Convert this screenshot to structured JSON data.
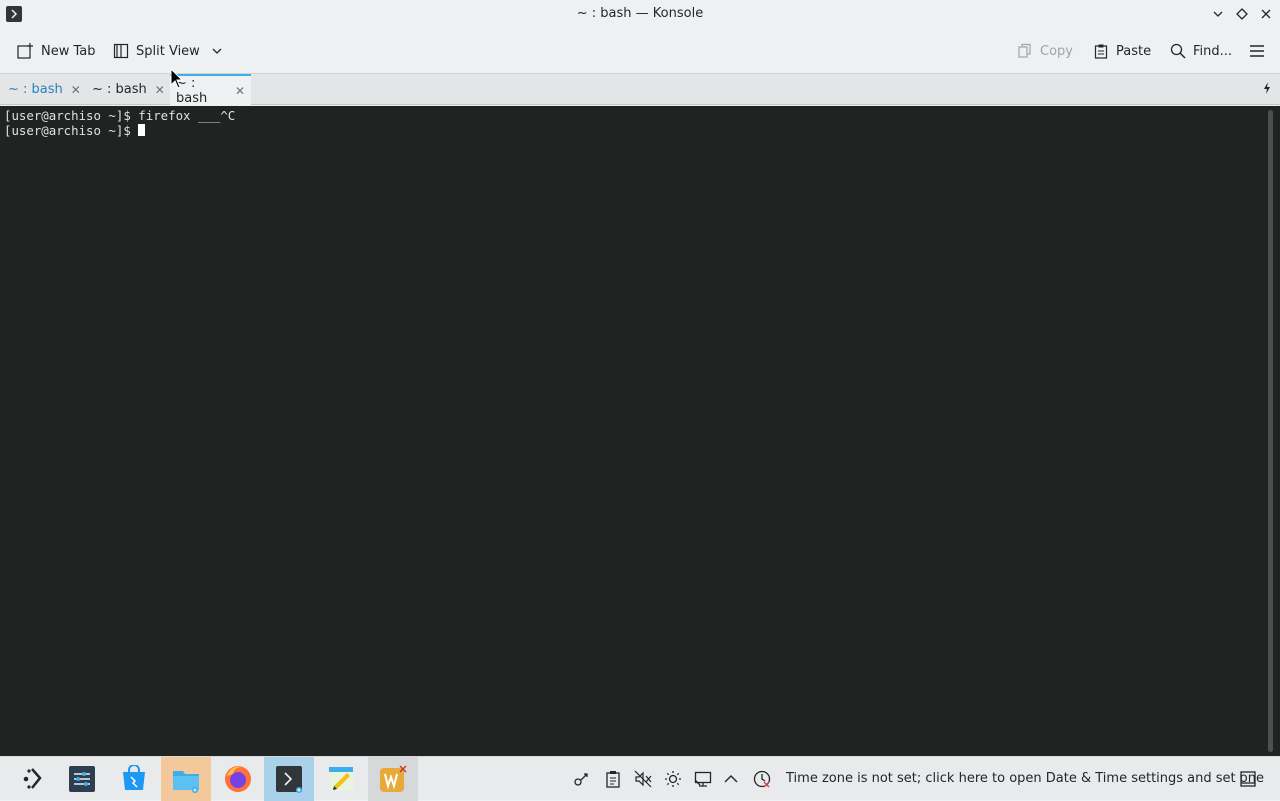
{
  "window": {
    "title": "~ : bash — Konsole"
  },
  "toolbar": {
    "new_tab": "New Tab",
    "split_view": "Split View",
    "copy": "Copy",
    "paste": "Paste",
    "find": "Find..."
  },
  "tabs": [
    {
      "label": "~ : bash",
      "active": false
    },
    {
      "label": "~ : bash",
      "active": false
    },
    {
      "label": "~ : bash",
      "active": true
    }
  ],
  "terminal": {
    "lines": [
      "[user@archiso ~]$ firefox ___^C",
      "[user@archiso ~]$ "
    ]
  },
  "taskbar": {
    "apps": [
      "application-launcher-icon",
      "system-settings-icon",
      "discover-icon",
      "dolphin-icon",
      "firefox-icon",
      "konsole-icon",
      "kate-icon",
      "wps-writer-icon"
    ],
    "tray_message": "Time zone is not set; click here to open Date & Time settings and set one"
  },
  "colors": {
    "terminal_bg": "#1f2423",
    "accent": "#3daee9",
    "panel_bg": "#eff0f1"
  }
}
